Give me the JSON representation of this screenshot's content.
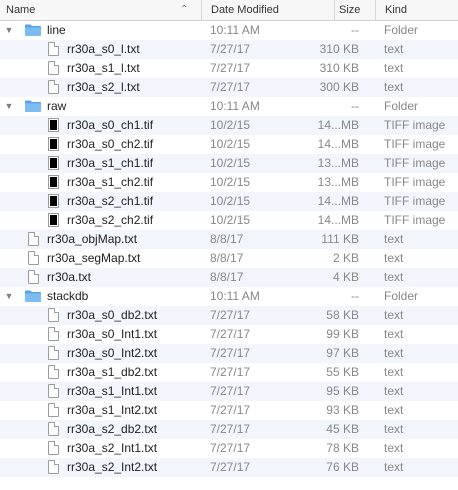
{
  "header": {
    "name": "Name",
    "date_modified": "Date Modified",
    "size": "Size",
    "kind": "Kind",
    "sort_glyph": "⌃"
  },
  "rows": [
    {
      "level": 0,
      "type": "folder",
      "expanded": true,
      "name": "line",
      "date": "10:11 AM",
      "size": "--",
      "kind": "Folder"
    },
    {
      "level": 1,
      "type": "text",
      "name": "rr30a_s0_l.txt",
      "date": "7/27/17",
      "size": "310 KB",
      "kind": "text"
    },
    {
      "level": 1,
      "type": "text",
      "name": "rr30a_s1_l.txt",
      "date": "7/27/17",
      "size": "310 KB",
      "kind": "text"
    },
    {
      "level": 1,
      "type": "text",
      "name": "rr30a_s2_l.txt",
      "date": "7/27/17",
      "size": "300 KB",
      "kind": "text"
    },
    {
      "level": 0,
      "type": "folder",
      "expanded": true,
      "name": "raw",
      "date": "10:11 AM",
      "size": "--",
      "kind": "Folder"
    },
    {
      "level": 1,
      "type": "tiff",
      "name": "rr30a_s0_ch1.tif",
      "date": "10/2/15",
      "size": "14...MB",
      "kind": "TIFF image"
    },
    {
      "level": 1,
      "type": "tiff",
      "name": "rr30a_s0_ch2.tif",
      "date": "10/2/15",
      "size": "14...MB",
      "kind": "TIFF image"
    },
    {
      "level": 1,
      "type": "tiff",
      "name": "rr30a_s1_ch1.tif",
      "date": "10/2/15",
      "size": "13...MB",
      "kind": "TIFF image"
    },
    {
      "level": 1,
      "type": "tiff",
      "name": "rr30a_s1_ch2.tif",
      "date": "10/2/15",
      "size": "13...MB",
      "kind": "TIFF image"
    },
    {
      "level": 1,
      "type": "tiff",
      "name": "rr30a_s2_ch1.tif",
      "date": "10/2/15",
      "size": "14...MB",
      "kind": "TIFF image"
    },
    {
      "level": 1,
      "type": "tiff",
      "name": "rr30a_s2_ch2.tif",
      "date": "10/2/15",
      "size": "14...MB",
      "kind": "TIFF image"
    },
    {
      "level": 0,
      "type": "text",
      "name": "rr30a_objMap.txt",
      "date": "8/8/17",
      "size": "111 KB",
      "kind": "text"
    },
    {
      "level": 0,
      "type": "text",
      "name": "rr30a_segMap.txt",
      "date": "8/8/17",
      "size": "2 KB",
      "kind": "text"
    },
    {
      "level": 0,
      "type": "text",
      "name": "rr30a.txt",
      "date": "8/8/17",
      "size": "4 KB",
      "kind": "text"
    },
    {
      "level": 0,
      "type": "folder",
      "expanded": true,
      "name": "stackdb",
      "date": "10:11 AM",
      "size": "--",
      "kind": "Folder"
    },
    {
      "level": 1,
      "type": "text",
      "name": "rr30a_s0_db2.txt",
      "date": "7/27/17",
      "size": "58 KB",
      "kind": "text"
    },
    {
      "level": 1,
      "type": "text",
      "name": "rr30a_s0_Int1.txt",
      "date": "7/27/17",
      "size": "99 KB",
      "kind": "text"
    },
    {
      "level": 1,
      "type": "text",
      "name": "rr30a_s0_Int2.txt",
      "date": "7/27/17",
      "size": "97 KB",
      "kind": "text"
    },
    {
      "level": 1,
      "type": "text",
      "name": "rr30a_s1_db2.txt",
      "date": "7/27/17",
      "size": "55 KB",
      "kind": "text"
    },
    {
      "level": 1,
      "type": "text",
      "name": "rr30a_s1_Int1.txt",
      "date": "7/27/17",
      "size": "95 KB",
      "kind": "text"
    },
    {
      "level": 1,
      "type": "text",
      "name": "rr30a_s1_Int2.txt",
      "date": "7/27/17",
      "size": "93 KB",
      "kind": "text"
    },
    {
      "level": 1,
      "type": "text",
      "name": "rr30a_s2_db2.txt",
      "date": "7/27/17",
      "size": "45 KB",
      "kind": "text"
    },
    {
      "level": 1,
      "type": "text",
      "name": "rr30a_s2_Int1.txt",
      "date": "7/27/17",
      "size": "78 KB",
      "kind": "text"
    },
    {
      "level": 1,
      "type": "text",
      "name": "rr30a_s2_Int2.txt",
      "date": "7/27/17",
      "size": "76 KB",
      "kind": "text"
    }
  ],
  "colors": {
    "folder": "#5aa3e6",
    "row_alt": "#f2f5fb",
    "secondary_text": "#888888"
  }
}
